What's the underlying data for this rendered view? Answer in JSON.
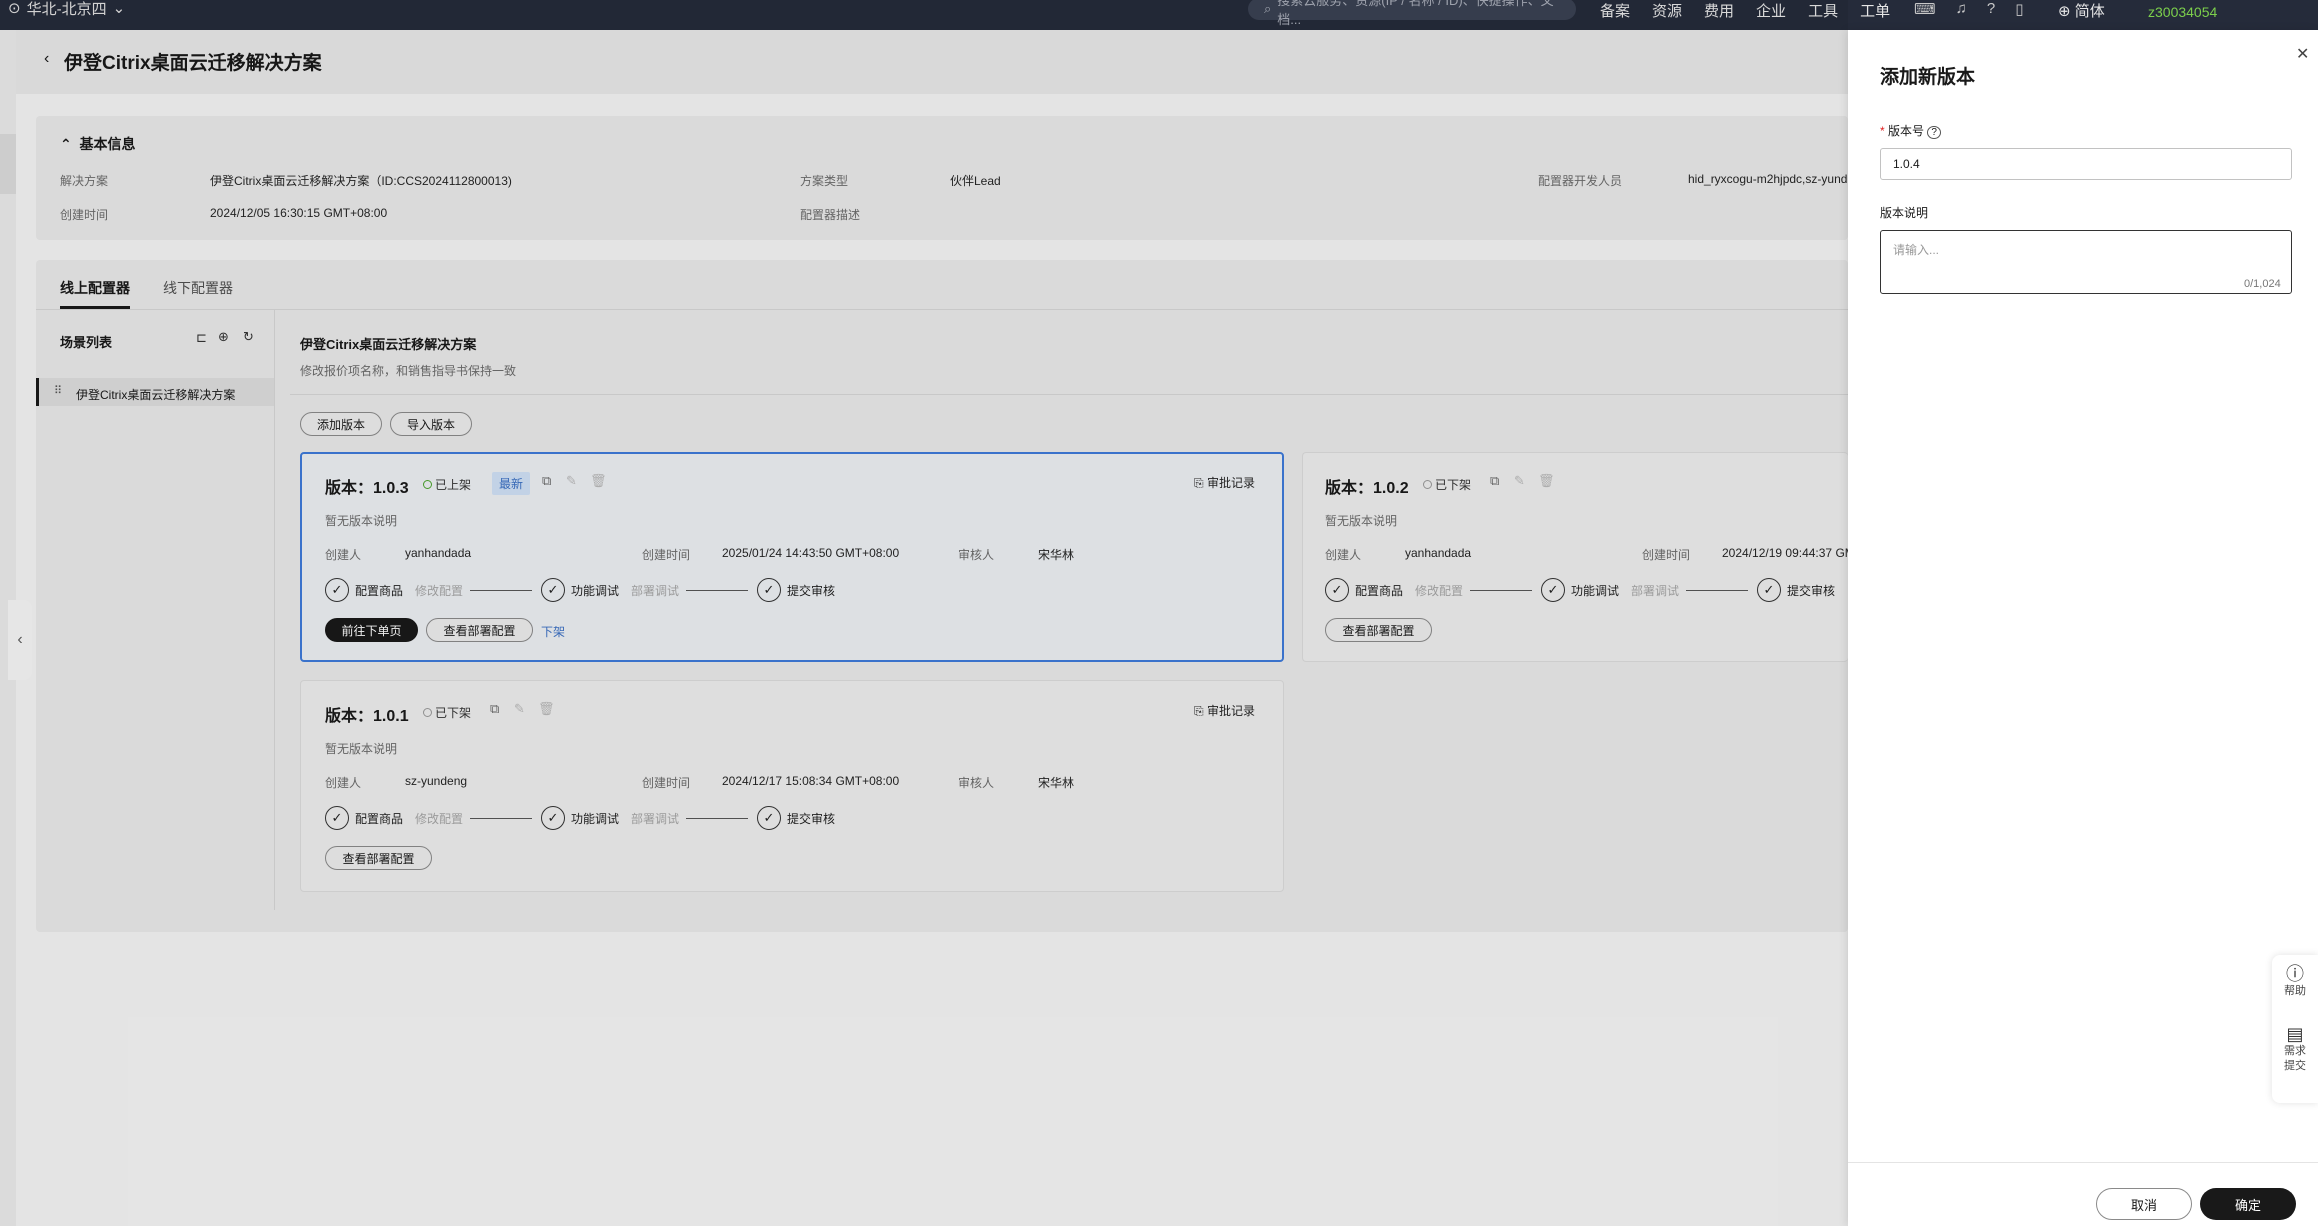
{
  "topbar": {
    "region": "华北-北京四",
    "search_placeholder": "搜索云服务、资源(IP / 名称 / ID)、快捷操作、文档...",
    "nav": [
      "备案",
      "资源",
      "费用",
      "企业",
      "工具",
      "工单"
    ],
    "lang": "简体",
    "user": "z30034054"
  },
  "page": {
    "title": "伊登Citrix桌面云迁移解决方案"
  },
  "basic": {
    "section_title": "基本信息",
    "fields": [
      {
        "label": "解决方案",
        "value": "伊登Citrix桌面云迁移解决方案（ID:CCS2024112800013)"
      },
      {
        "label": "方案类型",
        "value": "伙伴Lead"
      },
      {
        "label": "配置器开发人员",
        "value": "hid_ryxcogu-m2hjpdc,sz-yund"
      },
      {
        "label": "创建时间",
        "value": "2024/12/05 16:30:15 GMT+08:00"
      },
      {
        "label": "配置器描述",
        "value": ""
      }
    ]
  },
  "tabs": [
    "线上配置器",
    "线下配置器"
  ],
  "scene": {
    "title": "场景列表",
    "items": [
      "伊登Citrix桌面云迁移解决方案"
    ]
  },
  "content": {
    "title": "伊登Citrix桌面云迁移解决方案",
    "subtitle": "修改报价项名称，和销售指导书保持一致",
    "add_version": "添加版本",
    "import_version": "导入版本"
  },
  "versions": [
    {
      "title": "版本：1.0.3",
      "status": "已上架",
      "badge": "最新",
      "audit": "审批记录",
      "desc": "暂无版本说明",
      "creator_label": "创建人",
      "creator": "yanhandada",
      "time_label": "创建时间",
      "time": "2025/01/24 14:43:50 GMT+08:00",
      "reviewer_label": "审核人",
      "reviewer": "宋华林",
      "steps": [
        {
          "label": "配置商品",
          "sub": "修改配置"
        },
        {
          "label": "功能调试",
          "sub": "部署调试"
        },
        {
          "label": "提交审核",
          "sub": ""
        }
      ],
      "btn_primary": "前往下单页",
      "btn_secondary": "查看部署配置",
      "link": "下架"
    },
    {
      "title": "版本：1.0.2",
      "status": "已下架",
      "desc": "暂无版本说明",
      "creator_label": "创建人",
      "creator": "yanhandada",
      "time_label": "创建时间",
      "time": "2024/12/19 09:44:37 GM",
      "steps": [
        {
          "label": "配置商品",
          "sub": "修改配置"
        },
        {
          "label": "功能调试",
          "sub": "部署调试"
        },
        {
          "label": "提交审核",
          "sub": ""
        }
      ],
      "btn_secondary": "查看部署配置"
    },
    {
      "title": "版本：1.0.1",
      "status": "已下架",
      "audit": "审批记录",
      "desc": "暂无版本说明",
      "creator_label": "创建人",
      "creator": "sz-yundeng",
      "time_label": "创建时间",
      "time": "2024/12/17 15:08:34 GMT+08:00",
      "reviewer_label": "审核人",
      "reviewer": "宋华林",
      "steps": [
        {
          "label": "配置商品",
          "sub": "修改配置"
        },
        {
          "label": "功能调试",
          "sub": "部署调试"
        },
        {
          "label": "提交审核",
          "sub": ""
        }
      ],
      "btn_secondary": "查看部署配置"
    }
  ],
  "drawer": {
    "title": "添加新版本",
    "version_label": "版本号",
    "version_value": "1.0.4",
    "desc_label": "版本说明",
    "desc_placeholder": "请输入...",
    "counter": "0/1,024",
    "cancel": "取消",
    "ok": "确定"
  },
  "float": {
    "help": "帮助",
    "req1": "需求",
    "req2": "提交"
  }
}
